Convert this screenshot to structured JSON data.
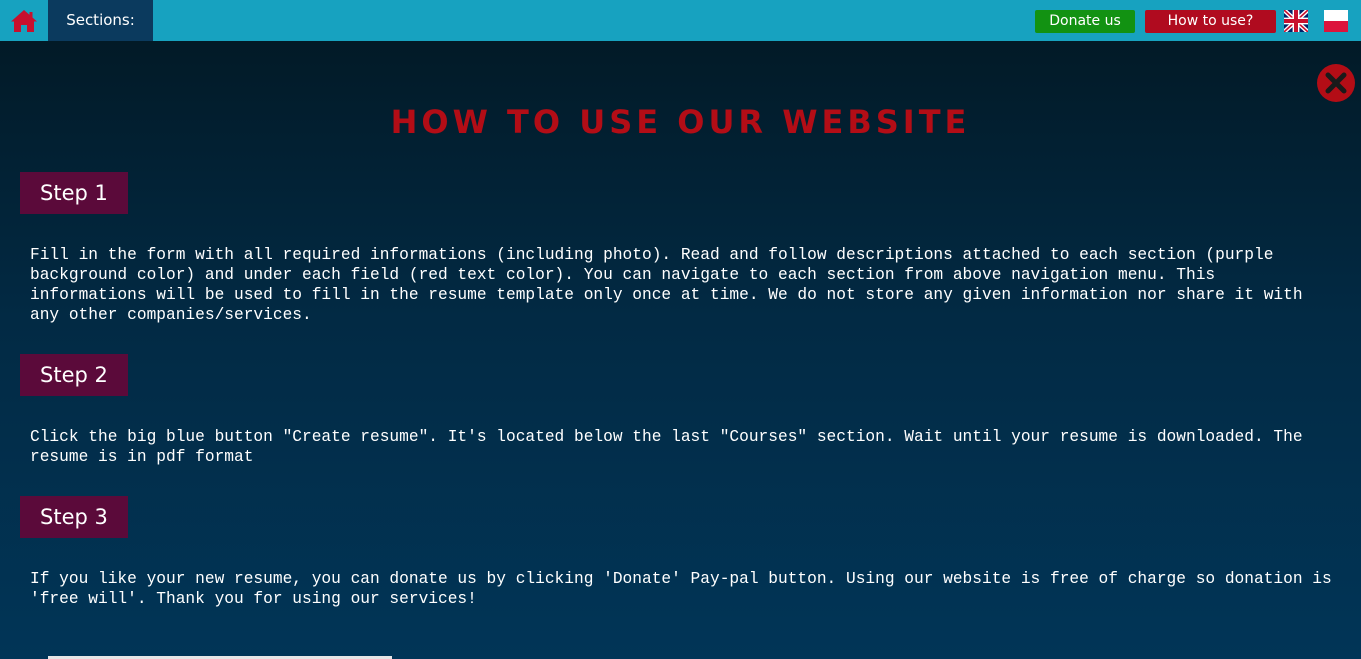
{
  "header": {
    "home_icon": "home-icon",
    "sections_label": "Sections:",
    "donate_label": "Donate us",
    "howto_label": "How to use?",
    "flags": [
      "uk-flag-icon",
      "pl-flag-icon"
    ],
    "colors": {
      "bar": "#17a2c0",
      "sections_bg": "#0b3a5e",
      "donate": "#129212",
      "howto": "#b00b1f",
      "home": "#c8102e"
    }
  },
  "modal": {
    "title": "HOW TO USE OUR WEBSITE",
    "close_icon": "close-icon",
    "steps": [
      {
        "label": "Step 1",
        "text": "Fill in the form with all required informations (including photo). Read and follow descriptions attached to each section (purple background color) and under each field (red text color). You can navigate to each section from above navigation menu. This informations will be used to fill in the resume template only once at time. We do not store any given information nor share it with any other companies/services."
      },
      {
        "label": "Step 2",
        "text": "Click the big blue button \"Create resume\". It's located below the last \"Courses\" section. Wait until your resume is downloaded. The resume is in pdf format"
      },
      {
        "label": "Step 3",
        "text": "If you like your new resume, you can donate us by clicking 'Donate' Pay-pal button. Using our website is free of charge so donation is 'free will'. Thank you for using our services!"
      }
    ],
    "colors": {
      "title": "#b30d16",
      "step_bg": "#5b0a3a",
      "text": "#ffffff"
    }
  }
}
